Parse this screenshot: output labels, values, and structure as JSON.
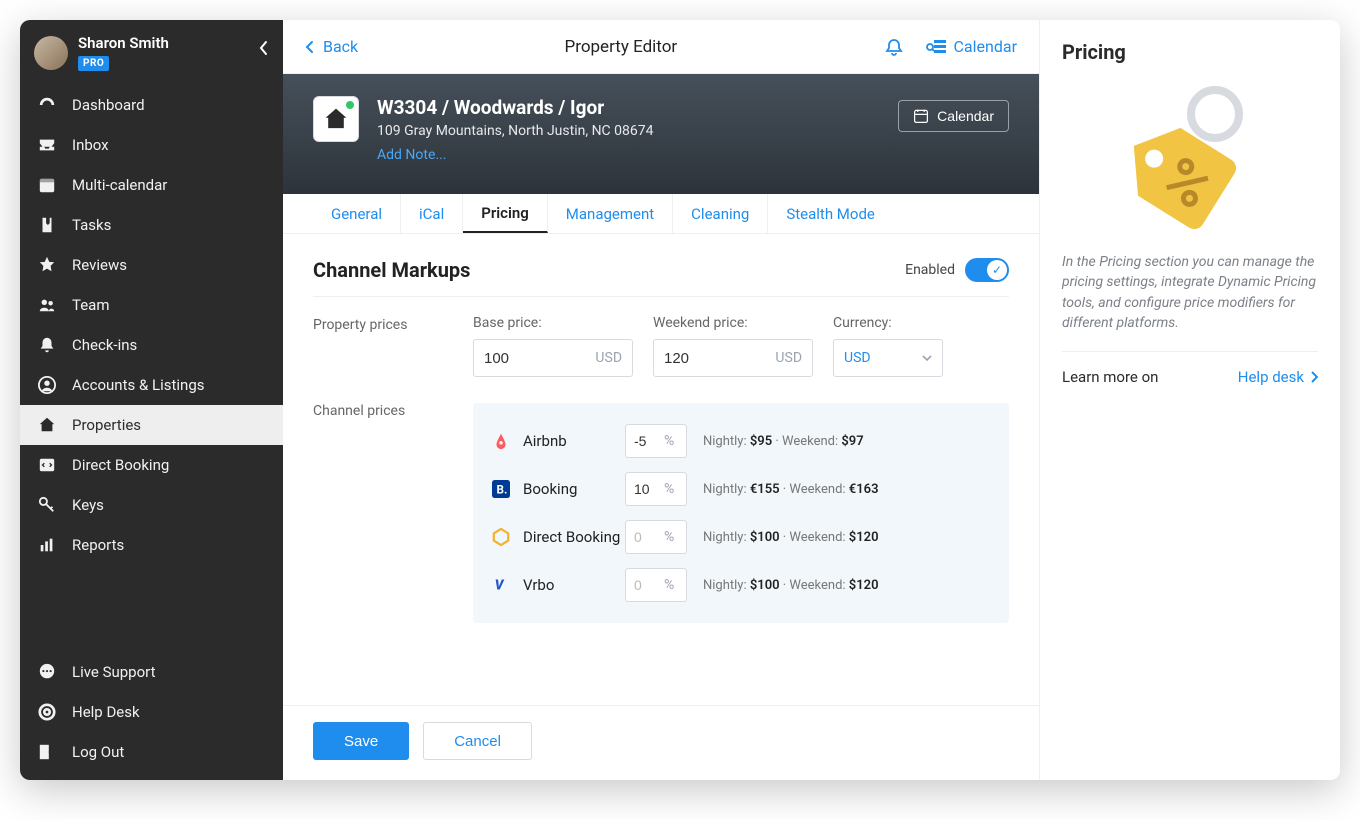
{
  "user": {
    "name": "Sharon Smith",
    "badge": "PRO"
  },
  "sidebar": {
    "items": [
      {
        "label": "Dashboard"
      },
      {
        "label": "Inbox"
      },
      {
        "label": "Multi-calendar"
      },
      {
        "label": "Tasks"
      },
      {
        "label": "Reviews"
      },
      {
        "label": "Team"
      },
      {
        "label": "Check-ins"
      },
      {
        "label": "Accounts & Listings"
      },
      {
        "label": "Properties"
      },
      {
        "label": "Direct Booking"
      },
      {
        "label": "Keys"
      },
      {
        "label": "Reports"
      }
    ],
    "footer": [
      {
        "label": "Live Support"
      },
      {
        "label": "Help Desk"
      },
      {
        "label": "Log Out"
      }
    ]
  },
  "topbar": {
    "back": "Back",
    "title": "Property Editor",
    "calendar": "Calendar"
  },
  "property": {
    "name": "W3304 / Woodwards / Igor",
    "address": "109 Gray Mountains, North Justin, NC 08674",
    "addNote": "Add Note...",
    "calendarBtn": "Calendar"
  },
  "tabs": [
    {
      "label": "General"
    },
    {
      "label": "iCal"
    },
    {
      "label": "Pricing",
      "active": true
    },
    {
      "label": "Management"
    },
    {
      "label": "Cleaning"
    },
    {
      "label": "Stealth Mode"
    }
  ],
  "section": {
    "title": "Channel Markups",
    "enabledLabel": "Enabled",
    "propertyPricesLabel": "Property prices",
    "channelPricesLabel": "Channel prices",
    "basePriceLabel": "Base price:",
    "weekendPriceLabel": "Weekend price:",
    "currencyLabel": "Currency:",
    "baseValue": "100",
    "baseSuffix": "USD",
    "weekendValue": "120",
    "weekendSuffix": "USD",
    "currencyValue": "USD"
  },
  "channels": [
    {
      "name": "Airbnb",
      "percent": "-5",
      "placeholder": false,
      "nightlyLabel": "Nightly:",
      "nightly": "$95",
      "weekendLabel": "Weekend:",
      "weekend": "$97"
    },
    {
      "name": "Booking",
      "percent": "10",
      "placeholder": false,
      "nightlyLabel": "Nightly:",
      "nightly": "€155",
      "weekendLabel": "Weekend:",
      "weekend": "€163"
    },
    {
      "name": "Direct Booking",
      "percent": "0",
      "placeholder": true,
      "nightlyLabel": "Nightly:",
      "nightly": "$100",
      "weekendLabel": "Weekend:",
      "weekend": "$120"
    },
    {
      "name": "Vrbo",
      "percent": "0",
      "placeholder": true,
      "nightlyLabel": "Nightly:",
      "nightly": "$100",
      "weekendLabel": "Weekend:",
      "weekend": "$120"
    }
  ],
  "footer": {
    "save": "Save",
    "cancel": "Cancel"
  },
  "rightPane": {
    "title": "Pricing",
    "desc": "In the Pricing section you can manage the pricing settings, integrate Dynamic Pricing tools, and configure price modifiers for different platforms.",
    "learnLabel": "Learn more on",
    "helpDesk": "Help desk"
  },
  "channelColors": {
    "airbnb": "#ff5a5f",
    "booking": "#003b95",
    "direct": "#f2b334",
    "vrbo": "#2457c5"
  }
}
